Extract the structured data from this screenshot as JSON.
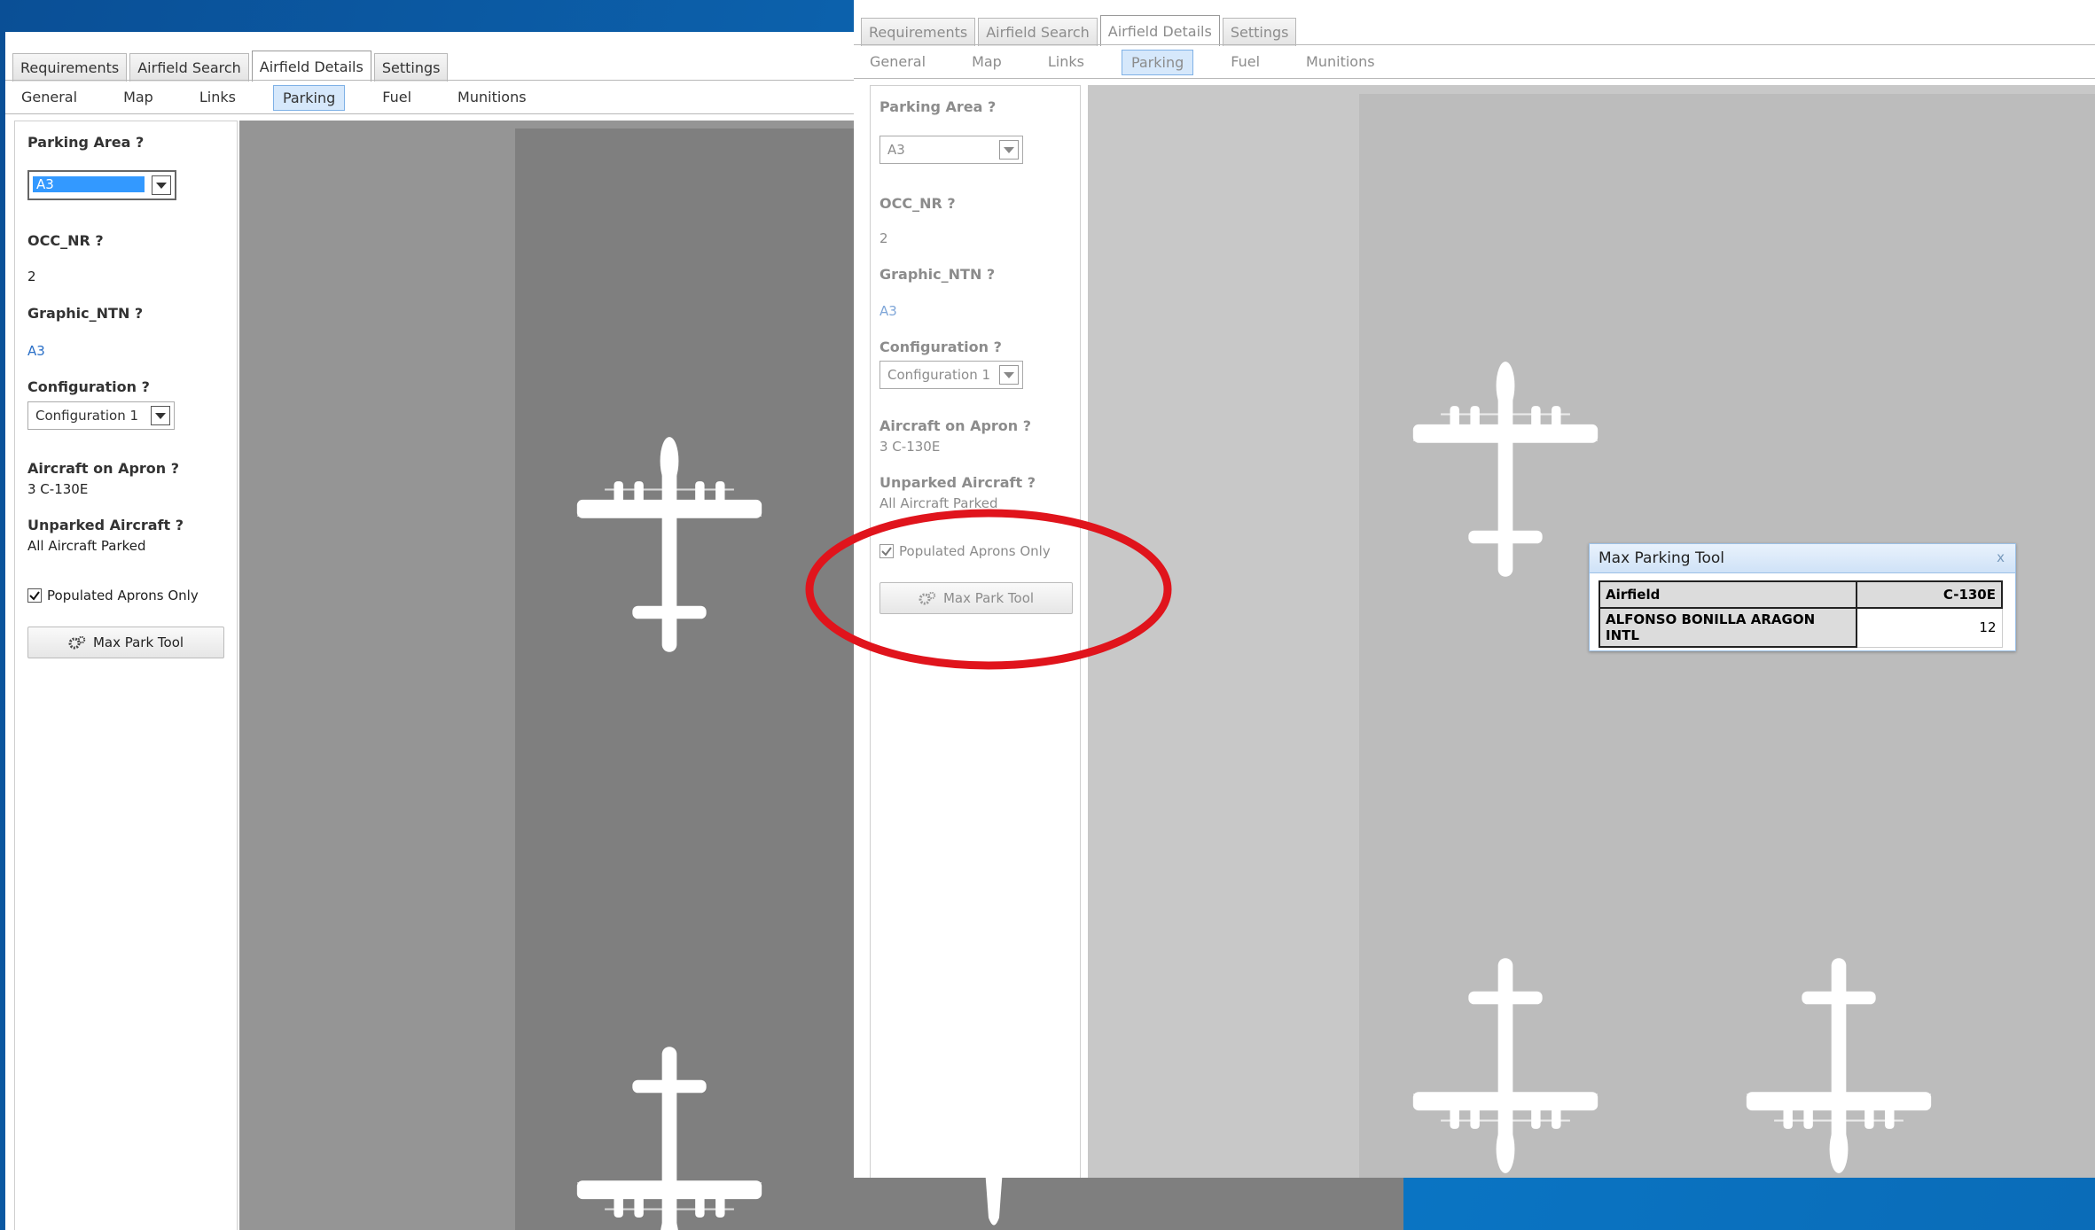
{
  "screen1": {
    "tabs": [
      "Requirements",
      "Airfield Search",
      "Airfield Details",
      "Settings"
    ],
    "subtabs": [
      "General",
      "Map",
      "Links",
      "Parking",
      "Fuel",
      "Munitions"
    ],
    "panel": {
      "parking_area_label": "Parking Area ?",
      "parking_area_value": "A3",
      "occ_nr_label": "OCC_NR ?",
      "occ_nr_value": "2",
      "graphic_ntn_label": "Graphic_NTN ?",
      "graphic_ntn_value": "A3",
      "configuration_label": "Configuration ?",
      "configuration_value": "Configuration 1",
      "aircraft_on_apron_label": "Aircraft on Apron ?",
      "aircraft_on_apron_value": "3 C-130E",
      "unparked_aircraft_label": "Unparked Aircraft ?",
      "unparked_aircraft_value": "All Aircraft Parked",
      "populated_aprons_label": "Populated Aprons Only",
      "max_park_tool_label": "Max Park Tool"
    }
  },
  "screen2": {
    "tabs": [
      "Requirements",
      "Airfield Search",
      "Airfield Details",
      "Settings"
    ],
    "subtabs": [
      "General",
      "Map",
      "Links",
      "Parking",
      "Fuel",
      "Munitions"
    ],
    "panel": {
      "parking_area_label": "Parking Area ?",
      "parking_area_value": "A3",
      "occ_nr_label": "OCC_NR ?",
      "occ_nr_value": "2",
      "graphic_ntn_label": "Graphic_NTN ?",
      "graphic_ntn_value": "A3",
      "configuration_label": "Configuration ?",
      "configuration_value": "Configuration 1",
      "aircraft_on_apron_label": "Aircraft on Apron ?",
      "aircraft_on_apron_value": "3 C-130E",
      "unparked_aircraft_label": "Unparked Aircraft ?",
      "unparked_aircraft_value": "All Aircraft Parked",
      "populated_aprons_label": "Populated Aprons Only",
      "max_park_tool_label": "Max Park Tool"
    },
    "max_parking_tool": {
      "title": "Max Parking Tool",
      "close": "x",
      "col_airfield": "Airfield",
      "col_aircraft": "C-130E",
      "row_airfield": "ALFONSO BONILLA ARAGON INTL",
      "row_count": "12"
    }
  },
  "colors": {
    "highlight_ellipse": "#e0141c",
    "apron_dark": "#808080",
    "apron_light": "#bcbcbc",
    "select_highlight": "#3399ff"
  },
  "icons": {
    "dropdown": "chevron-down-icon",
    "tool": "gears-icon",
    "close": "close-icon",
    "checkbox": "checkmark-icon",
    "aircraft": "aircraft-silhouette-icon"
  }
}
